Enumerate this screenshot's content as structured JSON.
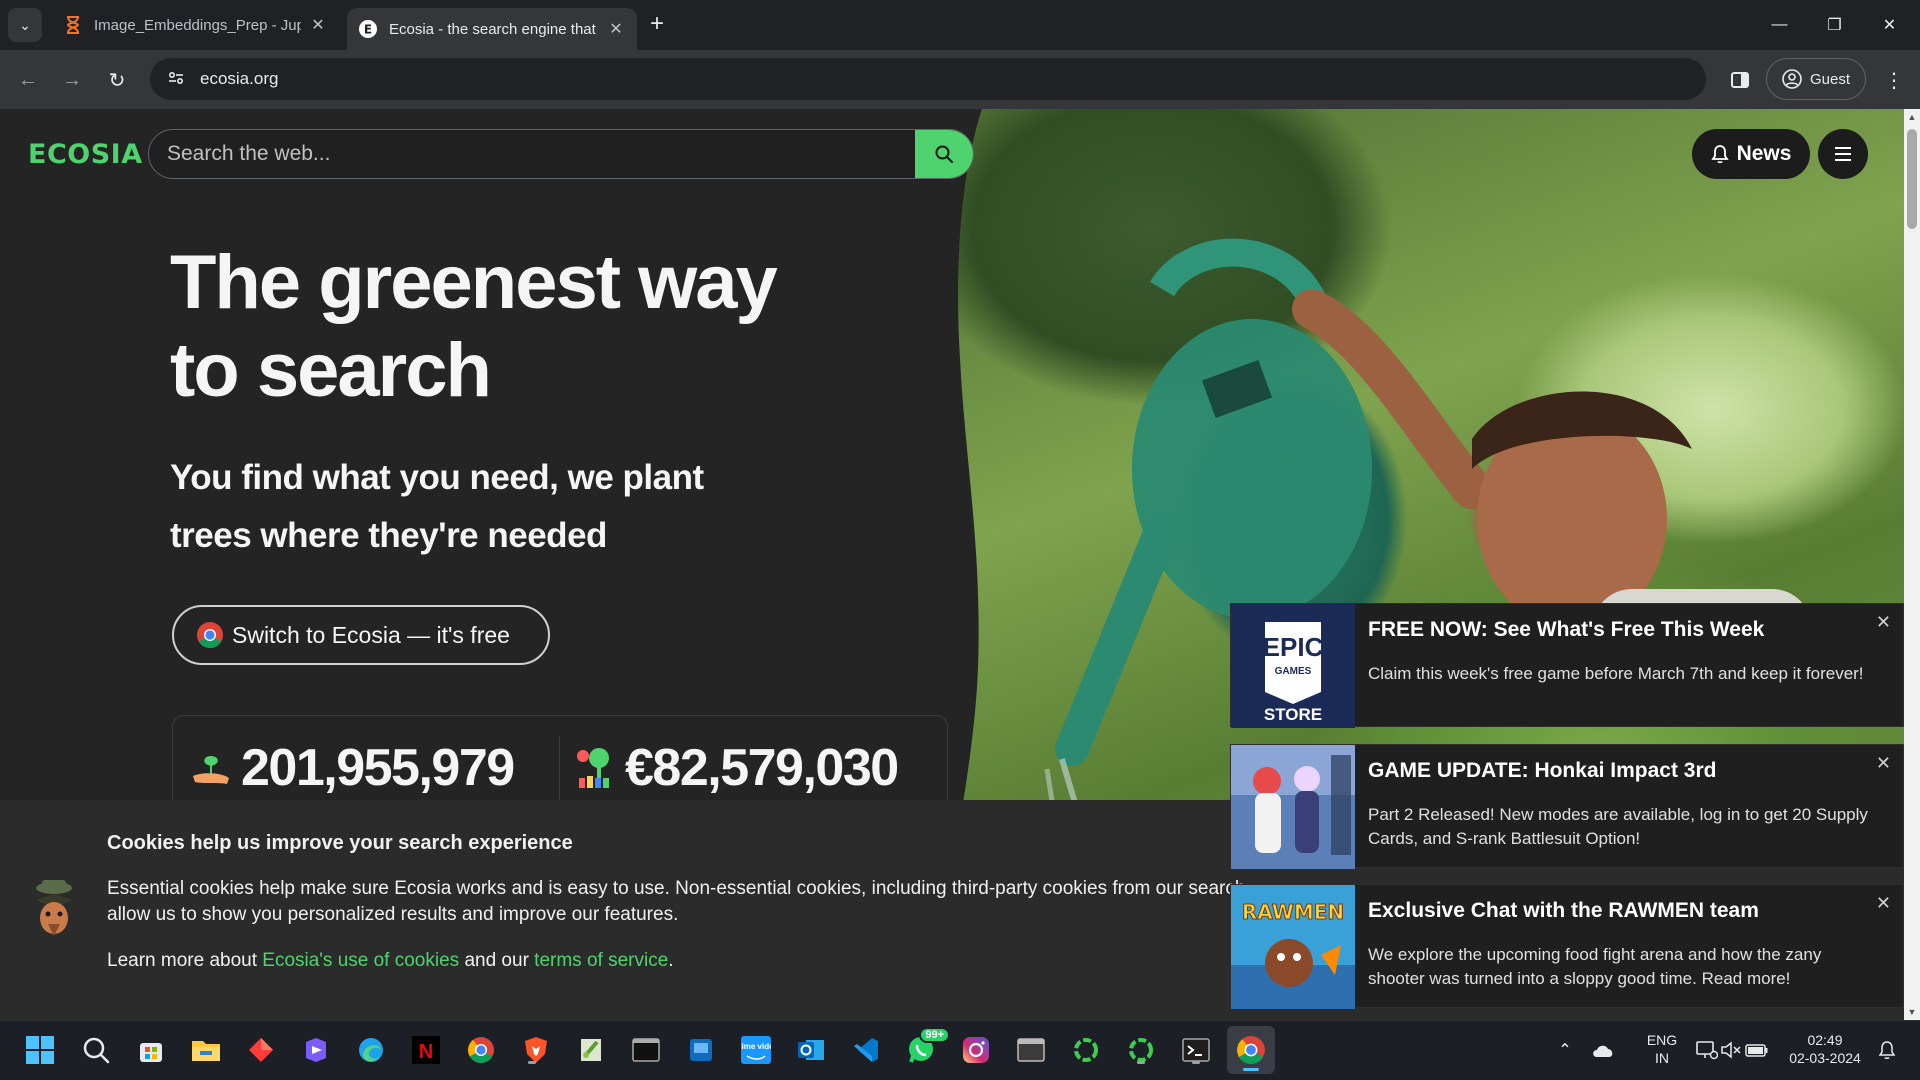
{
  "browser": {
    "tabs": [
      {
        "title": "Image_Embeddings_Prep - Jupyter",
        "active": false
      },
      {
        "title": "Ecosia - the search engine that plants trees",
        "active": true
      }
    ],
    "url": "ecosia.org",
    "profile_label": "Guest"
  },
  "page": {
    "logo": "ECOSIA",
    "search_placeholder": "Search the web...",
    "news_label": "News",
    "headline_line1": "The greenest way",
    "headline_line2": "to search",
    "subline_line1": "You find what you need, we plant",
    "subline_line2": "trees where they're needed",
    "switch_button": "Switch to Ecosia — it's free",
    "stats": [
      {
        "value": "201,955,979",
        "icon": "tree-in-hand-icon"
      },
      {
        "value": "€82,579,030",
        "icon": "tree-investment-icon"
      }
    ],
    "accent_color": "#4fd36e"
  },
  "cookie_banner": {
    "title": "Cookies help us improve your search experience",
    "body": "Essential cookies help make sure Ecosia works and is easy to use. Non-essential cookies, including third-party cookies from our search allow us to show you personalized results and improve our features.",
    "learn_prefix": "Learn more about ",
    "link1": "Ecosia's use of cookies",
    "learn_mid": " and our ",
    "link2": "terms of service",
    "learn_suffix": "."
  },
  "notifications": [
    {
      "title": "FREE NOW: See What's Free This Week",
      "text": "Claim this week's free game before March 7th and keep it forever!",
      "thumb": "epic-games-store-logo"
    },
    {
      "title": "GAME UPDATE: Honkai Impact 3rd",
      "text": "Part 2 Released! New modes are available, log in to get 20 Supply Cards, and S-rank Battlesuit Option!",
      "thumb": "honkai-characters-art"
    },
    {
      "title": "Exclusive Chat with the RAWMEN team",
      "text": "We explore the upcoming food fight arena and how the zany shooter was turned into a sloppy good time. Read more!",
      "thumb": "rawmen-game-art"
    }
  ],
  "epic_logo": {
    "line1": "EPIC",
    "line2": "GAMES",
    "line3": "STORE"
  },
  "rawmen_logo": "RAWMEN",
  "taskbar": {
    "apps": [
      "windows-start-icon",
      "search-icon",
      "microsoft-store-icon",
      "file-explorer-icon",
      "app-red-diamond-icon",
      "app-purple-icon",
      "edge-icon",
      "netflix-icon",
      "chrome-icon",
      "brave-icon",
      "notepad-plus-icon",
      "terminal-icon",
      "app-blue-icon",
      "prime-video-icon",
      "outlook-icon",
      "vscode-icon",
      "whatsapp-icon",
      "instagram-icon",
      "app-window-icon",
      "app-green-ring-icon",
      "app-green-ring2-icon",
      "terminal2-icon",
      "chrome-active-icon"
    ],
    "whatsapp_badge": "99+",
    "netflix_letter": "N",
    "prime_label": "prime video",
    "language_line1": "ENG",
    "language_line2": "IN",
    "time": "02:49",
    "date": "02-03-2024"
  }
}
